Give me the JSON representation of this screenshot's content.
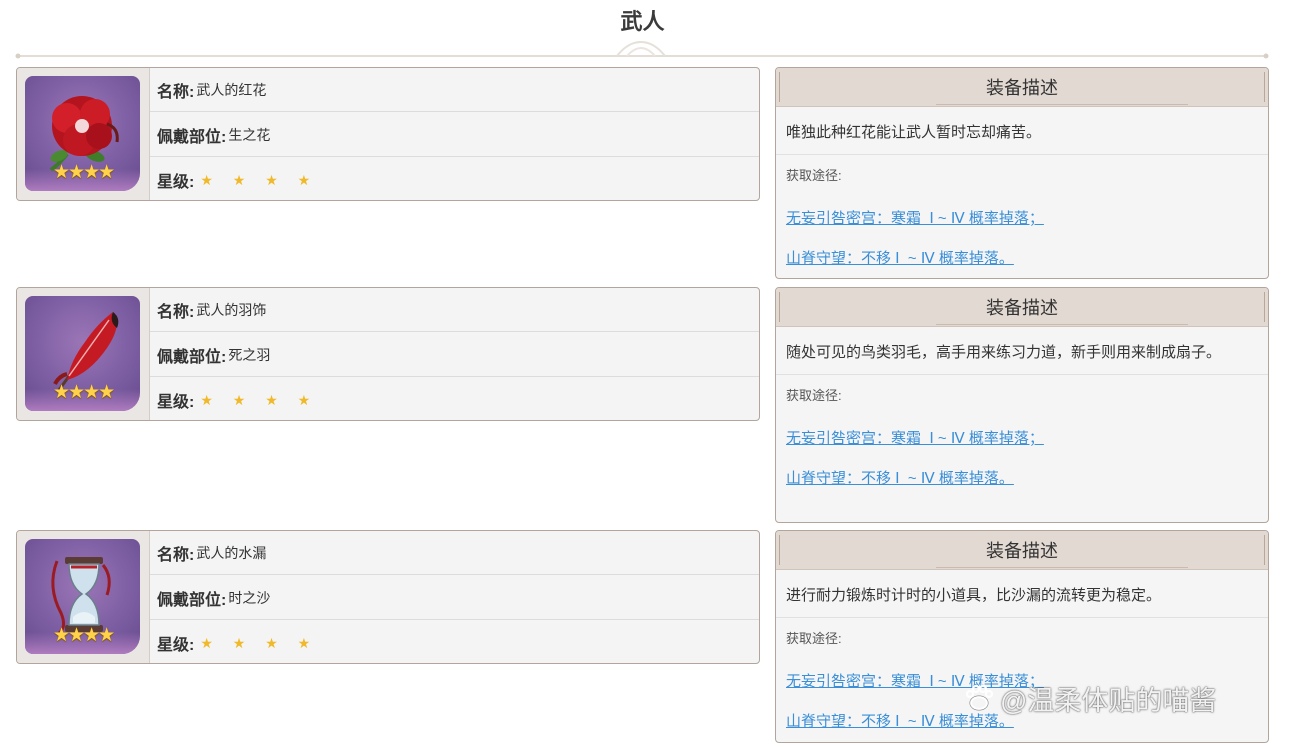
{
  "page": {
    "title": "武人"
  },
  "labels": {
    "name": "名称:",
    "slot": "佩戴部位:",
    "rarity": "星级:",
    "desc_header": "装备描述",
    "acquire": "获取途径:"
  },
  "items": [
    {
      "name": "武人的红花",
      "slot": "生之花",
      "stars": "★ ★ ★ ★",
      "rarity_value": 4,
      "icon": "red-flower-icon",
      "description": "唯独此种红花能让武人暂时忘却痛苦。",
      "sources": [
        "无妄引咎密宫：寒霜  Ⅰ ~ Ⅳ 概率掉落；",
        "山脊守望：不移 Ⅰ  ~ Ⅳ 概率掉落。"
      ]
    },
    {
      "name": "武人的羽饰",
      "slot": "死之羽",
      "stars": "★ ★ ★ ★",
      "rarity_value": 4,
      "icon": "red-feather-icon",
      "description": "随处可见的鸟类羽毛，高手用来练习力道，新手则用来制成扇子。",
      "sources": [
        "无妄引咎密宫：寒霜  Ⅰ ~ Ⅳ 概率掉落；",
        "山脊守望：不移 Ⅰ  ~ Ⅳ 概率掉落。"
      ]
    },
    {
      "name": "武人的水漏",
      "slot": "时之沙",
      "stars": "★ ★ ★ ★",
      "rarity_value": 4,
      "icon": "hourglass-icon",
      "description": "进行耐力锻炼时计时的小道具，比沙漏的流转更为稳定。",
      "sources": [
        "无妄引咎密宫：寒霜  Ⅰ ~ Ⅳ 概率掉落；",
        "山脊守望：不移 Ⅰ  ~ Ⅳ 概率掉落。"
      ]
    }
  ],
  "icon_stars": "★★★★",
  "watermark": {
    "text": "@温柔体贴的喵酱",
    "icon": "paw-logo-icon"
  },
  "colors": {
    "link": "#3a8fd8",
    "star": "#f0b92a",
    "header_bg": "#e2d9d2",
    "icon_bg": "#7d5ea3"
  }
}
